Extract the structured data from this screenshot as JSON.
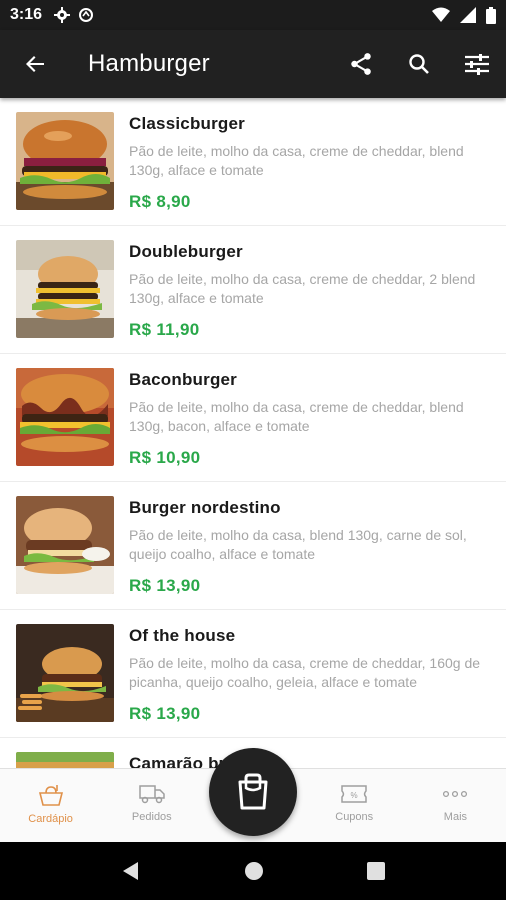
{
  "status_bar": {
    "time": "3:16"
  },
  "app_bar": {
    "title": "Hamburger"
  },
  "menu_items": [
    {
      "name": "Classicburger",
      "description": "Pão de leite, molho da casa, creme de cheddar, blend 130g, alface e tomate",
      "price": "R$ 8,90"
    },
    {
      "name": "Doubleburger",
      "description": "Pão de leite, molho da casa, creme de cheddar, 2 blend 130g, alface e tomate",
      "price": "R$ 11,90"
    },
    {
      "name": "Baconburger",
      "description": "Pão de leite, molho da casa, creme de cheddar, blend 130g, bacon, alface e tomate",
      "price": "R$ 10,90"
    },
    {
      "name": "Burger nordestino",
      "description": "Pão de leite, molho da casa, blend 130g, carne de sol, queijo coalho, alface e tomate",
      "price": "R$ 13,90"
    },
    {
      "name": "Of the house",
      "description": "Pão de leite, molho da casa, creme de cheddar, 160g de picanha, queijo coalho, geleia, alface e tomate",
      "price": "R$ 13,90"
    },
    {
      "name": "Camarão bu"
    }
  ],
  "bottom_nav": {
    "cardapio": "Cardápio",
    "pedidos": "Pedidos",
    "cupons": "Cupons",
    "mais": "Mais"
  },
  "colors": {
    "accent": "#e0914a",
    "price": "#2aa84a",
    "app_bar": "#212121"
  }
}
